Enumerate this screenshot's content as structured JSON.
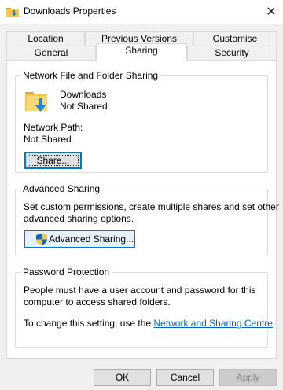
{
  "window": {
    "title": "Downloads Properties",
    "close_glyph": "✕"
  },
  "tabs": {
    "row1": [
      "Location",
      "Previous Versions",
      "Customise"
    ],
    "row2": [
      "General",
      "Sharing",
      "Security"
    ],
    "active": "Sharing"
  },
  "network_sharing": {
    "legend": "Network File and Folder Sharing",
    "folder_name": "Downloads",
    "folder_status": "Not Shared",
    "path_label": "Network Path:",
    "path_value": "Not Shared",
    "share_button": "Share..."
  },
  "advanced_sharing": {
    "legend": "Advanced Sharing",
    "description_line1": "Set custom permissions, create multiple shares and set other",
    "description_line2": "advanced sharing options.",
    "button": "Advanced Sharing..."
  },
  "password_protection": {
    "legend": "Password Protection",
    "description_line1": "People must have a user account and password for this",
    "description_line2": "computer to access shared folders.",
    "change_prefix": "To change this setting, use the",
    "link_text": "Network and Sharing Centre",
    "change_suffix": "."
  },
  "footer": {
    "ok": "OK",
    "cancel": "Cancel",
    "apply": "Apply"
  },
  "colors": {
    "accent": "#0078d7",
    "link": "#0066cc",
    "folder_yellow": "#f2c94c",
    "arrow_blue": "#1e88e5"
  },
  "icons": {
    "title": "folder-download-icon",
    "folder": "folder-download-icon",
    "shield": "uac-shield-icon",
    "close": "close-icon"
  }
}
